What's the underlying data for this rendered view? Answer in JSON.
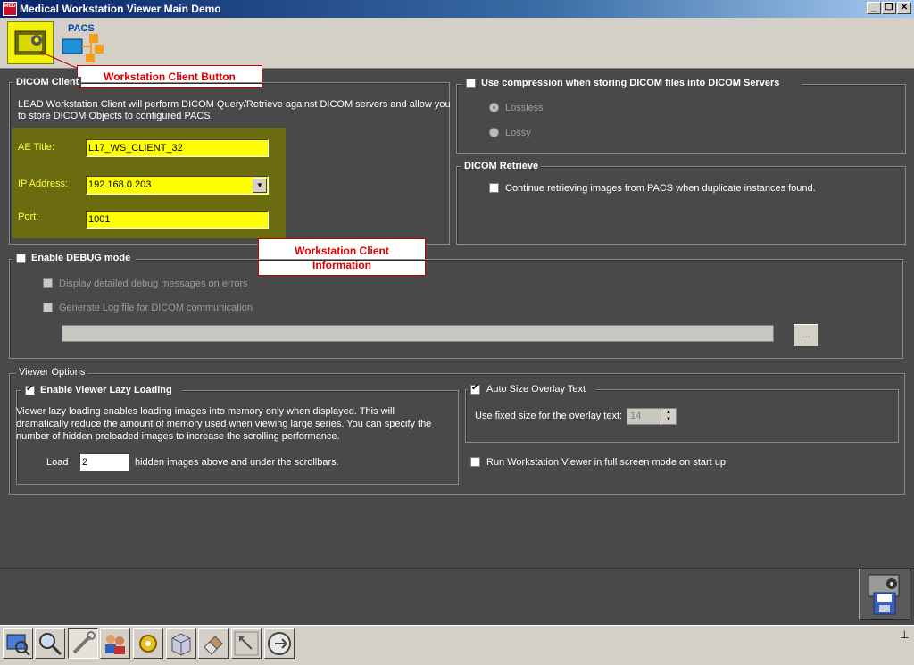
{
  "window": {
    "title": "Medical Workstation Viewer Main Demo",
    "app_icon_label": "MED"
  },
  "toolbar": {
    "pacs_label": "PACS"
  },
  "callouts": {
    "button": "Workstation Client Button",
    "info_line1": "Workstation Client",
    "info_line2": "Information"
  },
  "dicom_client": {
    "legend": "DICOM Client",
    "description_line1": "LEAD Workstation Client will perform DICOM Query/Retrieve against DICOM servers and allow you",
    "description_line2": "to store DICOM Objects to configured PACS.",
    "ae_title_label": "AE Title:",
    "ae_title_value": "L17_WS_CLIENT_32",
    "ip_label": "IP Address:",
    "ip_value": "192.168.0.203",
    "port_label": "Port:",
    "port_value": "1001"
  },
  "compression": {
    "label": "Use compression when storing DICOM files into DICOM Servers",
    "lossless": "Lossless",
    "lossy": "Lossy"
  },
  "retrieve": {
    "legend": "DICOM Retrieve",
    "continue_label": "Continue retrieving images from PACS when duplicate instances found."
  },
  "debug": {
    "label": "Enable DEBUG mode",
    "detailed_label": "Display detailed debug messages on errors",
    "log_label": "Generate Log file for DICOM communication",
    "browse_label": "..."
  },
  "viewer_options": {
    "legend": "Viewer Options",
    "lazy_label": "Enable Viewer Lazy Loading",
    "lazy_desc1": "Viewer lazy loading enables loading images into memory only when displayed. This will",
    "lazy_desc2": "dramatically reduce the amount of memory used when viewing large series. You can specify the",
    "lazy_desc3": "number of hidden preloaded images to increase the scrolling performance.",
    "load_label": "Load",
    "load_value": "2",
    "load_suffix": "hidden images above and under the scrollbars.",
    "auto_size_label": "Auto Size Overlay Text",
    "fixed_size_label": "Use fixed size for the overlay text:",
    "fixed_size_value": "14",
    "fullscreen_label": "Run Workstation Viewer in full screen mode on start up"
  },
  "colors": {
    "highlight": "#ffff00",
    "background": "#494949",
    "callout_text": "#e00000"
  }
}
